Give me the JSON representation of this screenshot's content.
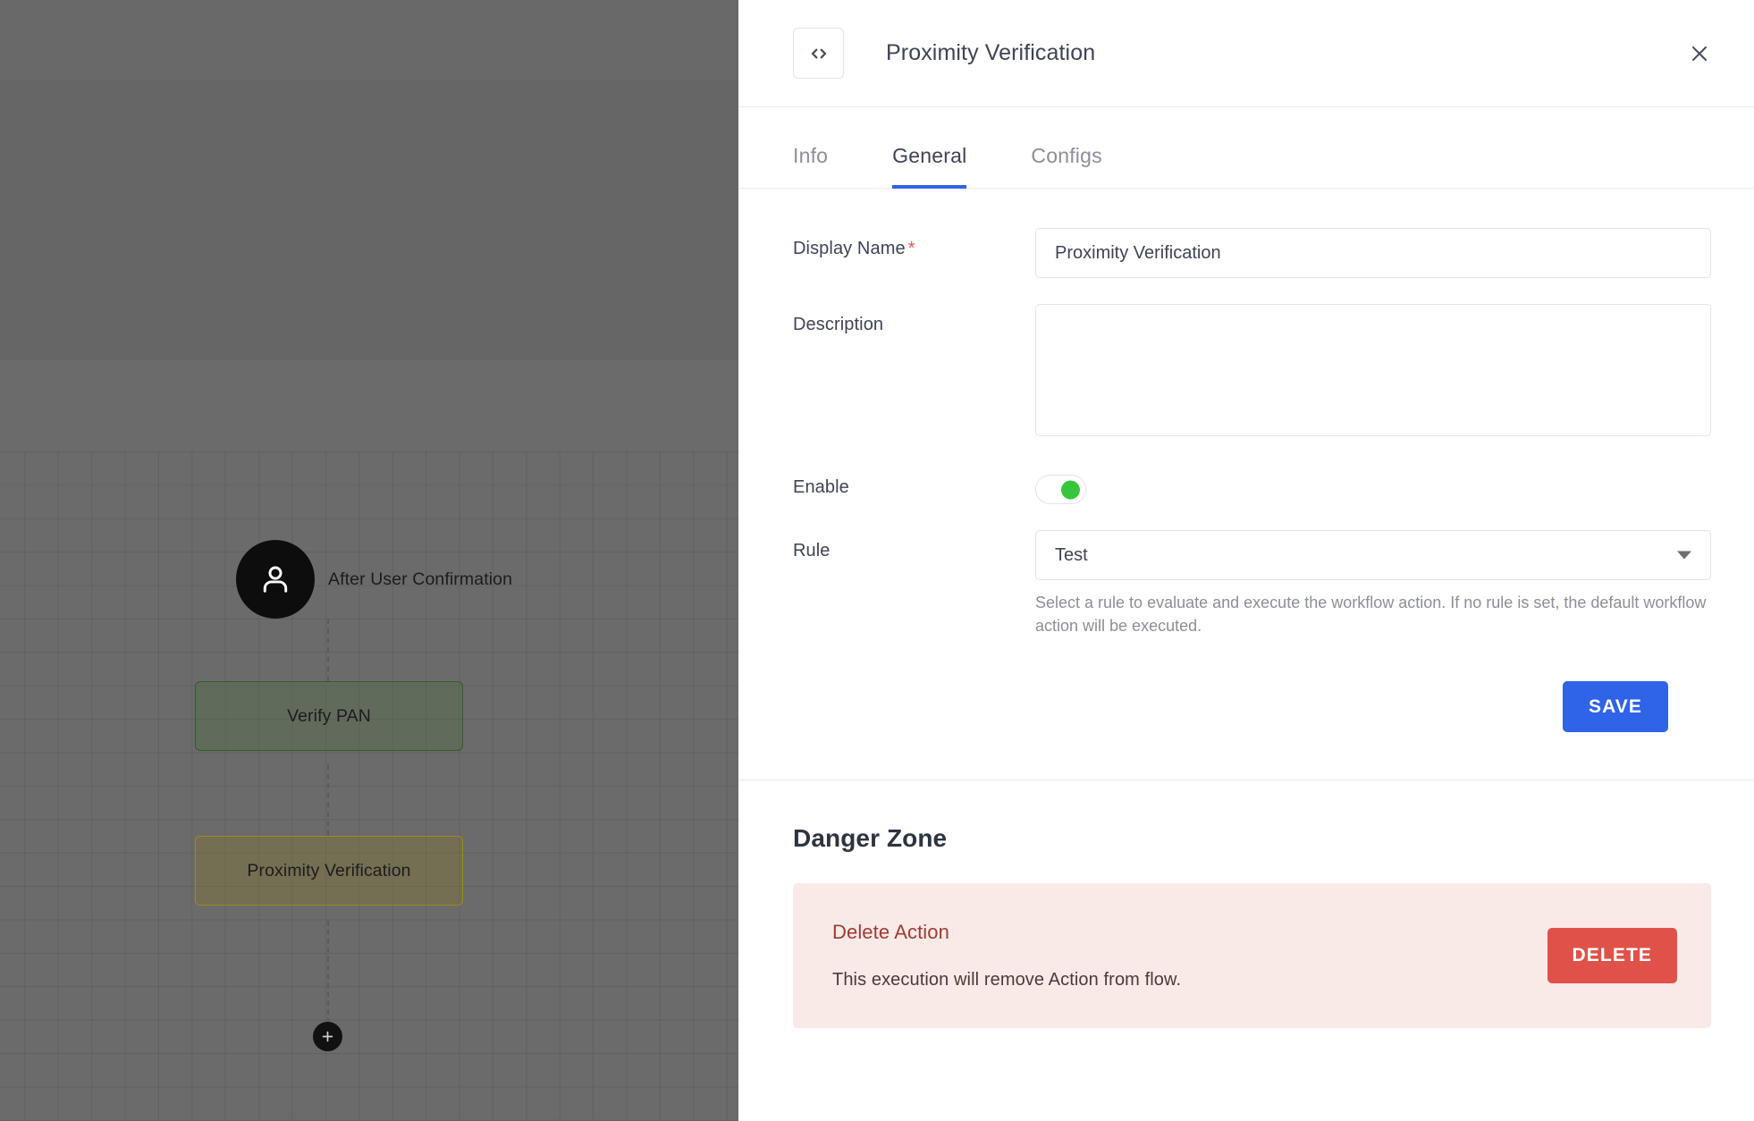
{
  "canvas": {
    "trigger": {
      "icon": "user-icon",
      "label": "After User Confirmation"
    },
    "nodes": [
      {
        "label": "Verify PAN",
        "accent": "#2f5e20"
      },
      {
        "label": "Proximity Verification",
        "accent": "#9a8a1c"
      }
    ],
    "add_node_icon": "plus-icon"
  },
  "panel": {
    "header": {
      "code_icon": "code-brackets-icon",
      "title": "Proximity Verification",
      "close_icon": "close-icon"
    },
    "tabs": [
      {
        "label": "Info",
        "active": false
      },
      {
        "label": "General",
        "active": true
      },
      {
        "label": "Configs",
        "active": false
      }
    ],
    "form": {
      "display_name": {
        "label": "Display Name",
        "required_marker": "*",
        "value": "Proximity Verification",
        "placeholder": ""
      },
      "description": {
        "label": "Description",
        "value": "",
        "placeholder": ""
      },
      "enable": {
        "label": "Enable",
        "checked": true,
        "knob_color": "#35c63c"
      },
      "rule": {
        "label": "Rule",
        "value": "Test",
        "options": [
          "Test"
        ],
        "caret_icon": "chevron-down-icon",
        "helper": "Select a rule to evaluate and execute the workflow action. If no rule is set, the default workflow action will be executed."
      },
      "save_label": "SAVE"
    },
    "danger_zone": {
      "title": "Danger Zone",
      "action_title": "Delete Action",
      "action_desc": "This execution will remove Action from flow.",
      "delete_label": "DELETE"
    }
  },
  "colors": {
    "primary": "#2f63e8",
    "danger": "#e05249",
    "danger_bg": "#faeae7",
    "success": "#35c63c"
  }
}
